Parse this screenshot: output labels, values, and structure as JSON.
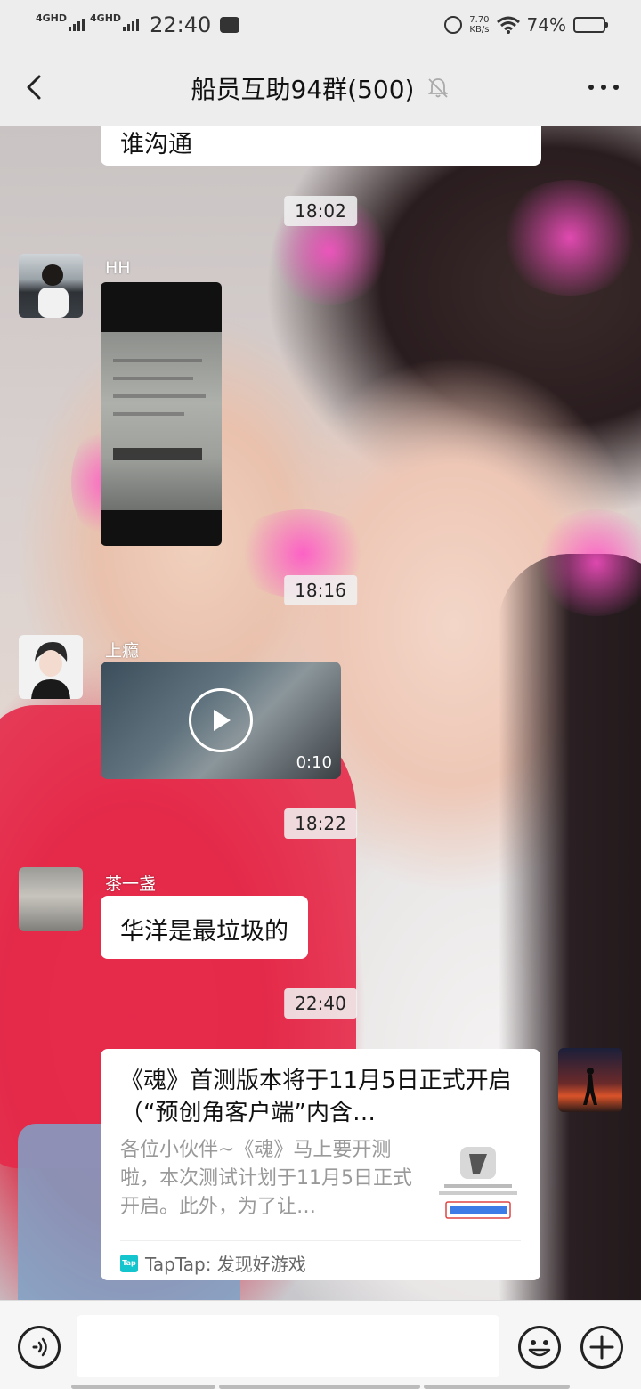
{
  "status_bar": {
    "net1": "4GHD",
    "net2": "4GHD",
    "time": "22:40",
    "speed_value": "7.70",
    "speed_unit": "KB/s",
    "battery_pct": "74%",
    "battery_level": 0.74
  },
  "nav": {
    "title": "船员互助94群(500)",
    "back_icon": "chevron-left-icon",
    "mute_icon": "bell-off-icon",
    "more_icon": "more-dots-icon"
  },
  "messages": {
    "partial_text": "谁沟通",
    "ts1": "18:02",
    "hh_nick": "HH",
    "ts2": "18:16",
    "shangyin_nick": "上瘾",
    "video_duration": "0:10",
    "ts3": "18:22",
    "tea_nick": "茶一盏",
    "tea_text": "华洋是最垃圾的",
    "ts4": "22:40"
  },
  "card": {
    "title": "《魂》首测版本将于11月5日正式开启（“预创角客户端”内含…",
    "desc": "各位小伙伴~《魂》马上要开测啦，本次测试计划于11月5日正式开启。此外，为了让…",
    "source_logo": "Tap",
    "source": "TapTap: 发现好游戏"
  },
  "colors": {
    "nav_bg": "#ededed",
    "bubble_bg": "#ffffff",
    "taptap": "#15c5ce"
  }
}
